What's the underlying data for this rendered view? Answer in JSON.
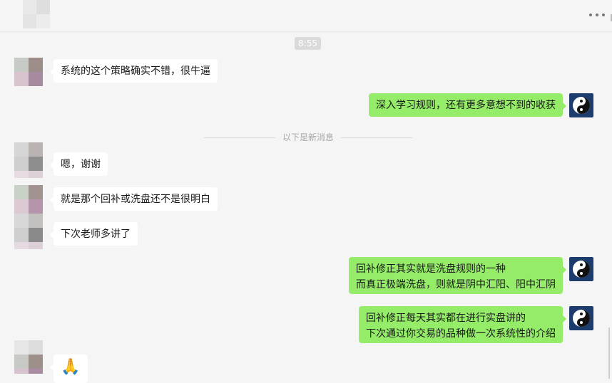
{
  "chat": {
    "time": "8:55",
    "divider": "以下是新消息",
    "messages": [
      {
        "text": "系统的这个策略确实不错，很牛逼"
      },
      {
        "text": "深入学习规则，还有更多意想不到的收获"
      },
      {
        "text": "嗯，谢谢"
      },
      {
        "text": "就是那个回补或洗盘还不是很明白"
      },
      {
        "text": "下次老师多讲了"
      },
      {
        "lines": [
          "回补修正其实就是洗盘规则的一种",
          "而真正极端洗盘，则就是阴中汇阳、阳中汇阴"
        ]
      },
      {
        "lines": [
          "回补修正每天其实都在进行实盘讲的",
          "下次通过你交易的品种做一次系统性的介绍"
        ]
      },
      {
        "emoji": "🙏"
      }
    ]
  },
  "icons": {
    "more": "more-icon",
    "self_avatar": "yin-yang-icon"
  },
  "colors": {
    "sent_bubble": "#95ec69",
    "received_bubble": "#ffffff",
    "background": "#f5f5f5",
    "avatar_bg": "#1d3c6e"
  }
}
